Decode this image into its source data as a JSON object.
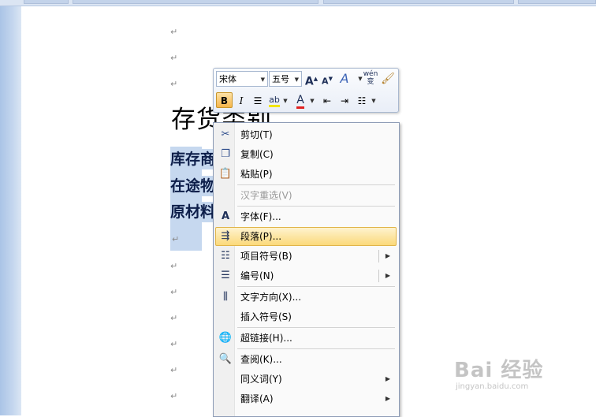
{
  "document": {
    "paragraph_mark": "↵",
    "heading": "存货类别",
    "selected_lines": [
      "库存商品",
      "在途物资",
      "原材料"
    ]
  },
  "mini_toolbar": {
    "font_name": "宋体",
    "font_size": "五号",
    "grow_font": "A",
    "shrink_font": "A",
    "styles": "A",
    "phonetic": "wén 变",
    "bold": "B",
    "italic": "I",
    "font_color": "A",
    "highlight": "ab"
  },
  "context_menu": {
    "items": [
      {
        "label": "剪切(T)",
        "icon": "scissors-icon",
        "enabled": true
      },
      {
        "label": "复制(C)",
        "icon": "copy-icon",
        "enabled": true
      },
      {
        "label": "粘贴(P)",
        "icon": "paste-icon",
        "enabled": true
      },
      {
        "label": "汉字重选(V)",
        "icon": "",
        "enabled": false
      },
      {
        "label": "字体(F)...",
        "icon": "font-icon",
        "enabled": true
      },
      {
        "label": "段落(P)...",
        "icon": "paragraph-icon",
        "enabled": true,
        "highlighted": true
      },
      {
        "label": "项目符号(B)",
        "icon": "bullets-icon",
        "enabled": true,
        "submenu": true
      },
      {
        "label": "编号(N)",
        "icon": "numbering-icon",
        "enabled": true,
        "submenu": true
      },
      {
        "label": "文字方向(X)...",
        "icon": "text-direction-icon",
        "enabled": true
      },
      {
        "label": "插入符号(S)",
        "icon": "",
        "enabled": true
      },
      {
        "label": "超链接(H)...",
        "icon": "hyperlink-icon",
        "enabled": true
      },
      {
        "label": "查阅(K)...",
        "icon": "lookup-icon",
        "enabled": true
      },
      {
        "label": "同义词(Y)",
        "icon": "",
        "enabled": true,
        "submenu": true
      },
      {
        "label": "翻译(A)",
        "icon": "",
        "enabled": true,
        "submenu": true
      }
    ]
  },
  "watermark": {
    "main": "Bai 经验",
    "sub": "jingyan.baidu.com"
  },
  "colors": {
    "selection": "#c6d8ef",
    "menu_highlight": "#fbd97a",
    "font_color_bar": "#e02020"
  }
}
